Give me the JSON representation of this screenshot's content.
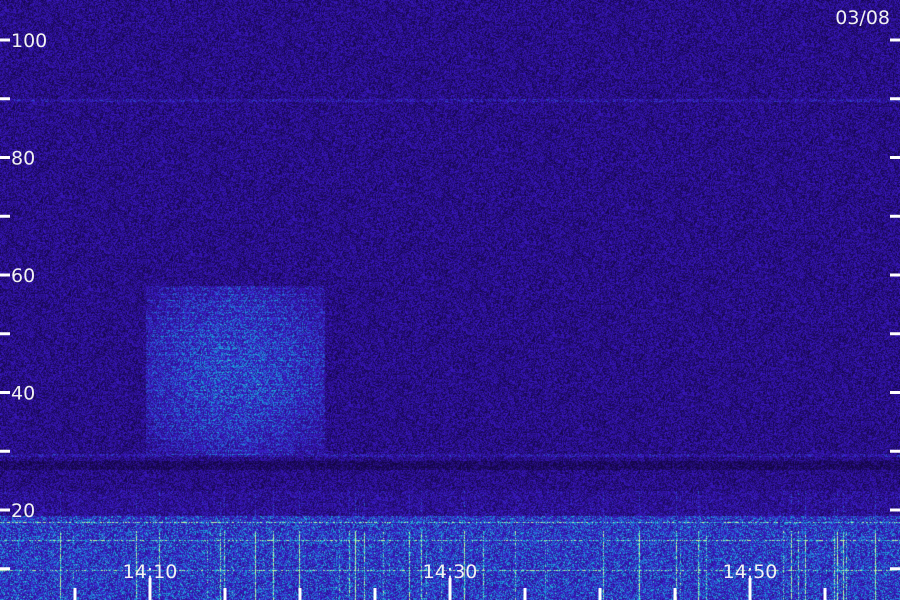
{
  "chart_data": {
    "type": "heatmap",
    "title": "03/08",
    "xlabel": "",
    "ylabel": "",
    "x_ticks": [
      "14:10",
      "14:30",
      "14:50"
    ],
    "y_ticks": [
      100,
      80,
      60,
      40,
      20
    ],
    "ylim": [
      0,
      110
    ],
    "legend": "none",
    "grid": false,
    "colors": {
      "background": "#1a0a5c",
      "noise": "#3a1fb0",
      "strong": "#2fe0c8",
      "peak": "#ffffff"
    }
  }
}
